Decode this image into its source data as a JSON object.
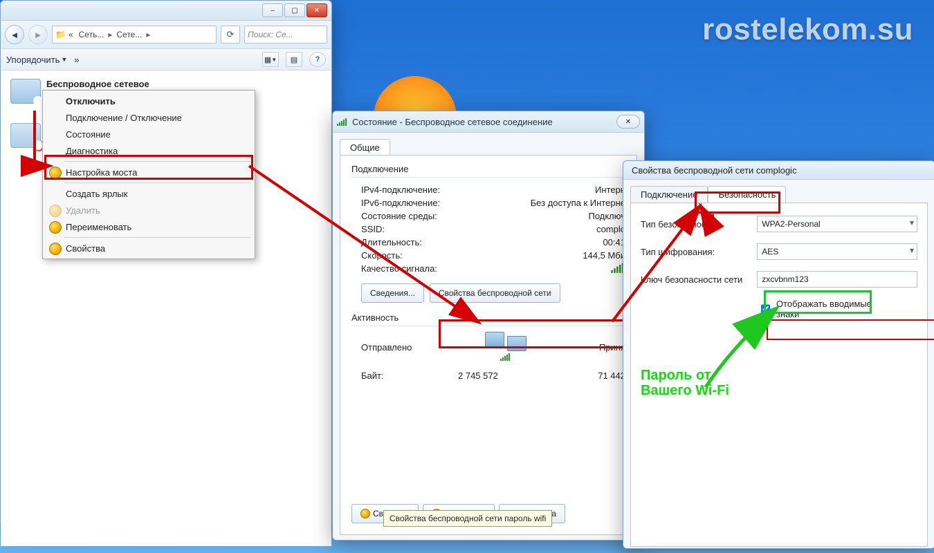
{
  "watermark": "rostelekom.su",
  "explorer": {
    "back_aria": "Назад",
    "fwd_aria": "Вперёд",
    "crumb_pre": "«",
    "crumb1": "Сеть...",
    "crumb2": "Сете...",
    "crumb_tail": "▸",
    "refresh": "⟳",
    "search_placeholder": "Поиск: Се...",
    "toolbar": {
      "organize": "Упорядочить",
      "more": "»"
    },
    "item1": "Беспроводное сетевое",
    "ctx": {
      "disconnect": "Отключить",
      "connect": "Подключение / Отключение",
      "status": "Состояние",
      "diag": "Диагностика",
      "bridge": "Настройка моста",
      "shortcut": "Создать ярлык",
      "delete": "Удалить",
      "rename": "Переименовать",
      "props": "Свойства"
    }
  },
  "status": {
    "title": "Состояние - Беспроводное сетевое соединение",
    "tab": "Общие",
    "grp_conn": "Подключение",
    "rows": {
      "ipv4": {
        "k": "IPv4-подключение:",
        "v": "Интерн"
      },
      "ipv6": {
        "k": "IPv6-подключение:",
        "v": "Без доступа к Интерне"
      },
      "media": {
        "k": "Состояние среды:",
        "v": "Подключ"
      },
      "ssid": {
        "k": "SSID:",
        "v": "complo"
      },
      "dur": {
        "k": "Длительность:",
        "v": "00:41"
      },
      "speed": {
        "k": "Скорость:",
        "v": "144,5 Мби"
      },
      "signal": {
        "k": "Качество сигнала:"
      }
    },
    "btn_details": "Сведения...",
    "btn_wprops": "Свойства беспроводной сети",
    "grp_act": "Активность",
    "sent": "Отправлено",
    "recv": "Приня",
    "bytes": "Байт:",
    "sent_v": "2 745 572",
    "recv_v": "71 442",
    "btn_props": "Свойства",
    "btn_disable": "Отключить",
    "btn_diag": "Диагностика",
    "tooltip": "Свойства беспроводной сети пароль wifi"
  },
  "props": {
    "title": "Свойства беспроводной сети complogic",
    "tab_conn": "Подключение",
    "tab_sec": "Безопасность",
    "lbl_sectype": "Тип безопасности:",
    "val_sectype": "WPA2-Personal",
    "lbl_enc": "Тип шифрования:",
    "val_enc": "AES",
    "lbl_key": "Ключ безопасности сети",
    "val_key": "zxcvbnm123",
    "chk_show": "Отображать вводимые знаки"
  },
  "annot": {
    "pwd": "Пароль от\nВашего Wi-Fi"
  }
}
